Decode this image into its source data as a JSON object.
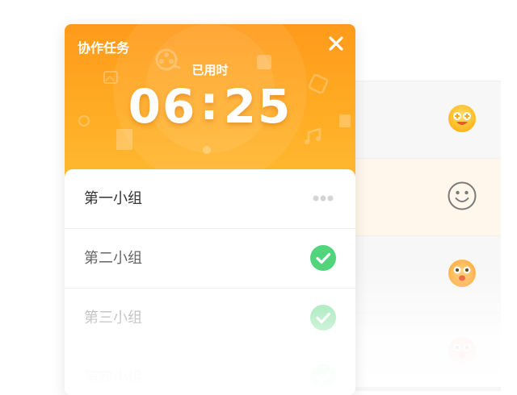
{
  "header": {
    "title": "协作任务",
    "elapsed_label": "已用时",
    "timer_minutes": "06",
    "timer_separator": ":",
    "timer_seconds": "25",
    "accent_color": "#ffa21f"
  },
  "groups": [
    {
      "label": "第一小组",
      "status": "in-progress",
      "status_icon": "more-dots-icon"
    },
    {
      "label": "第二小组",
      "status": "done",
      "status_icon": "check-circle-icon"
    },
    {
      "label": "第三小组",
      "status": "done",
      "status_icon": "check-circle-icon"
    },
    {
      "label": "第四小组",
      "status": "done",
      "status_icon": "check-circle-icon"
    }
  ],
  "background_rows": [
    {
      "emoji": "star-eyes-emoji-icon"
    },
    {
      "emoji": "smile-outline-icon"
    },
    {
      "emoji": "surprised-emoji-icon"
    },
    {
      "emoji": "surprised-emoji-icon"
    }
  ],
  "colors": {
    "check_green": "#52d47c",
    "highlight_row": "#fff7ec",
    "emoji_yellow": "#ffc532"
  }
}
